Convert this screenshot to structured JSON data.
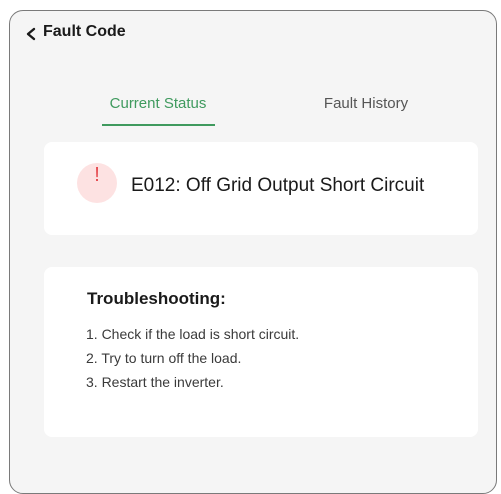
{
  "header": {
    "title": "Fault Code"
  },
  "tabs": [
    {
      "label": "Current Status",
      "active": true
    },
    {
      "label": "Fault History",
      "active": false
    }
  ],
  "fault": {
    "icon": "exclamation-icon",
    "text": "E012: Off Grid Output Short Circuit"
  },
  "troubleshooting": {
    "title": "Troubleshooting:",
    "steps": [
      "1. Check if the load is short circuit.",
      "2. Try to turn off the load.",
      "3. Restart the inverter."
    ]
  },
  "colors": {
    "accent": "#3f9a5e",
    "alert": "#e5484d",
    "alert_bg": "#fde2e2",
    "background": "#f5f5f5"
  }
}
